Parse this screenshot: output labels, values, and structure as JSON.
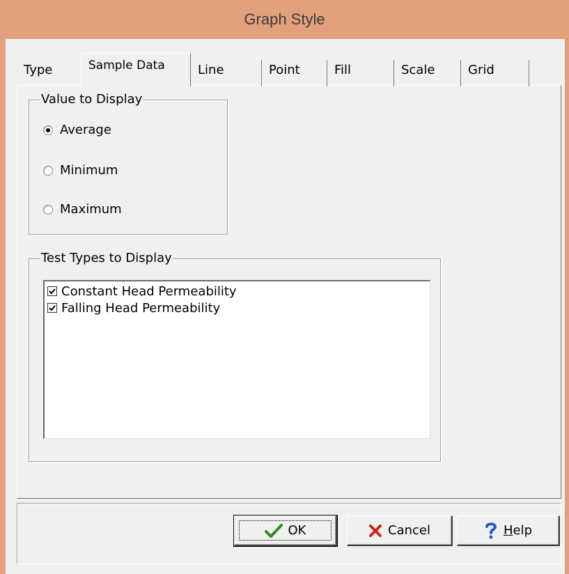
{
  "window": {
    "title": "Graph Style"
  },
  "tabs": [
    {
      "label": "Type",
      "active": false
    },
    {
      "label": "Sample Data",
      "active": true
    },
    {
      "label": "Line",
      "active": false
    },
    {
      "label": "Point",
      "active": false
    },
    {
      "label": "Fill",
      "active": false
    },
    {
      "label": "Scale",
      "active": false
    },
    {
      "label": "Grid",
      "active": false
    }
  ],
  "value_group": {
    "label": "Value to Display",
    "options": [
      {
        "label": "Average",
        "selected": true
      },
      {
        "label": "Minimum",
        "selected": false
      },
      {
        "label": "Maximum",
        "selected": false
      }
    ]
  },
  "test_types_group": {
    "label": "Test Types to Display",
    "items": [
      {
        "label": "Constant Head Permeability",
        "checked": true
      },
      {
        "label": "Falling Head Permeability",
        "checked": true
      }
    ]
  },
  "buttons": {
    "ok": "OK",
    "cancel": "Cancel",
    "help_prefix": "",
    "help_mnemonic": "H",
    "help_rest": "elp"
  },
  "colors": {
    "titlebar": "#e3a07c",
    "ok_icon": "#2e8b1f",
    "cancel_icon": "#c0281e",
    "help_icon": "#1f5fbf"
  },
  "icons": {
    "ok": "checkmark-icon",
    "cancel": "x-icon",
    "help": "question-icon"
  }
}
